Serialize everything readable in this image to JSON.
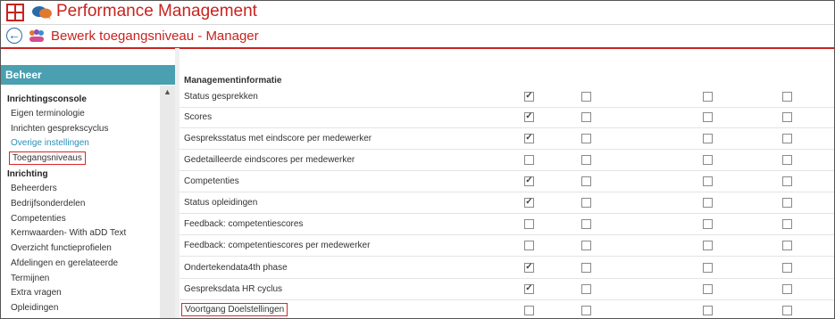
{
  "app": {
    "title": "Performance Management"
  },
  "subheader": {
    "title": "Bewerk toegangsniveau - Manager"
  },
  "sidebar": {
    "header": "Beheer",
    "sections": [
      {
        "label": "Inrichtingsconsole",
        "items": [
          {
            "label": "Eigen terminologie"
          },
          {
            "label": "Inrichten gesprekscyclus"
          },
          {
            "label": "Overige instellingen"
          },
          {
            "label": "Toegangsniveaus"
          }
        ]
      },
      {
        "label": "Inrichting",
        "items": [
          {
            "label": "Beheerders"
          },
          {
            "label": "Bedrijfsonderdelen"
          },
          {
            "label": "Competenties"
          },
          {
            "label": "Kernwaarden- With aDD Text"
          },
          {
            "label": "Overzicht functieprofielen"
          },
          {
            "label": "Afdelingen en gerelateerde"
          },
          {
            "label": "Termijnen"
          },
          {
            "label": "Extra vragen"
          },
          {
            "label": "Opleidingen"
          }
        ]
      }
    ]
  },
  "main": {
    "section_title": "Managementinformatie",
    "rows": [
      {
        "label": "Status gesprekken",
        "checks": [
          true,
          false,
          false,
          false
        ]
      },
      {
        "label": "Scores",
        "checks": [
          true,
          false,
          false,
          false
        ]
      },
      {
        "label": "Gespreksstatus met eindscore per medewerker",
        "checks": [
          true,
          false,
          false,
          false
        ]
      },
      {
        "label": "Gedetailleerde eindscores per medewerker",
        "checks": [
          false,
          false,
          false,
          false
        ]
      },
      {
        "label": "Competenties",
        "checks": [
          true,
          false,
          false,
          false
        ]
      },
      {
        "label": "Status opleidingen",
        "checks": [
          true,
          false,
          false,
          false
        ]
      },
      {
        "label": "Feedback: competentiescores",
        "checks": [
          false,
          false,
          false,
          false
        ]
      },
      {
        "label": "Feedback: competentiescores per medewerker",
        "checks": [
          false,
          false,
          false,
          false
        ]
      },
      {
        "label": "Ondertekendata4th phase",
        "checks": [
          true,
          false,
          false,
          false
        ]
      },
      {
        "label": "Gespreksdata HR cyclus",
        "checks": [
          true,
          false,
          false,
          false
        ]
      },
      {
        "label": "Voortgang Doelstellingen",
        "checks": [
          false,
          false,
          false,
          false
        ]
      }
    ]
  },
  "colors": {
    "brand_red": "#c8231f",
    "sidebar_header": "#4a9fb0",
    "link": "#2a8fb6",
    "highlight_box": "#d9252b"
  },
  "icons": [
    "app-grid-icon",
    "chat-bubbles-icon",
    "back-arrow-icon",
    "people-group-icon",
    "scroll-up-icon",
    "checkbox-icon"
  ]
}
